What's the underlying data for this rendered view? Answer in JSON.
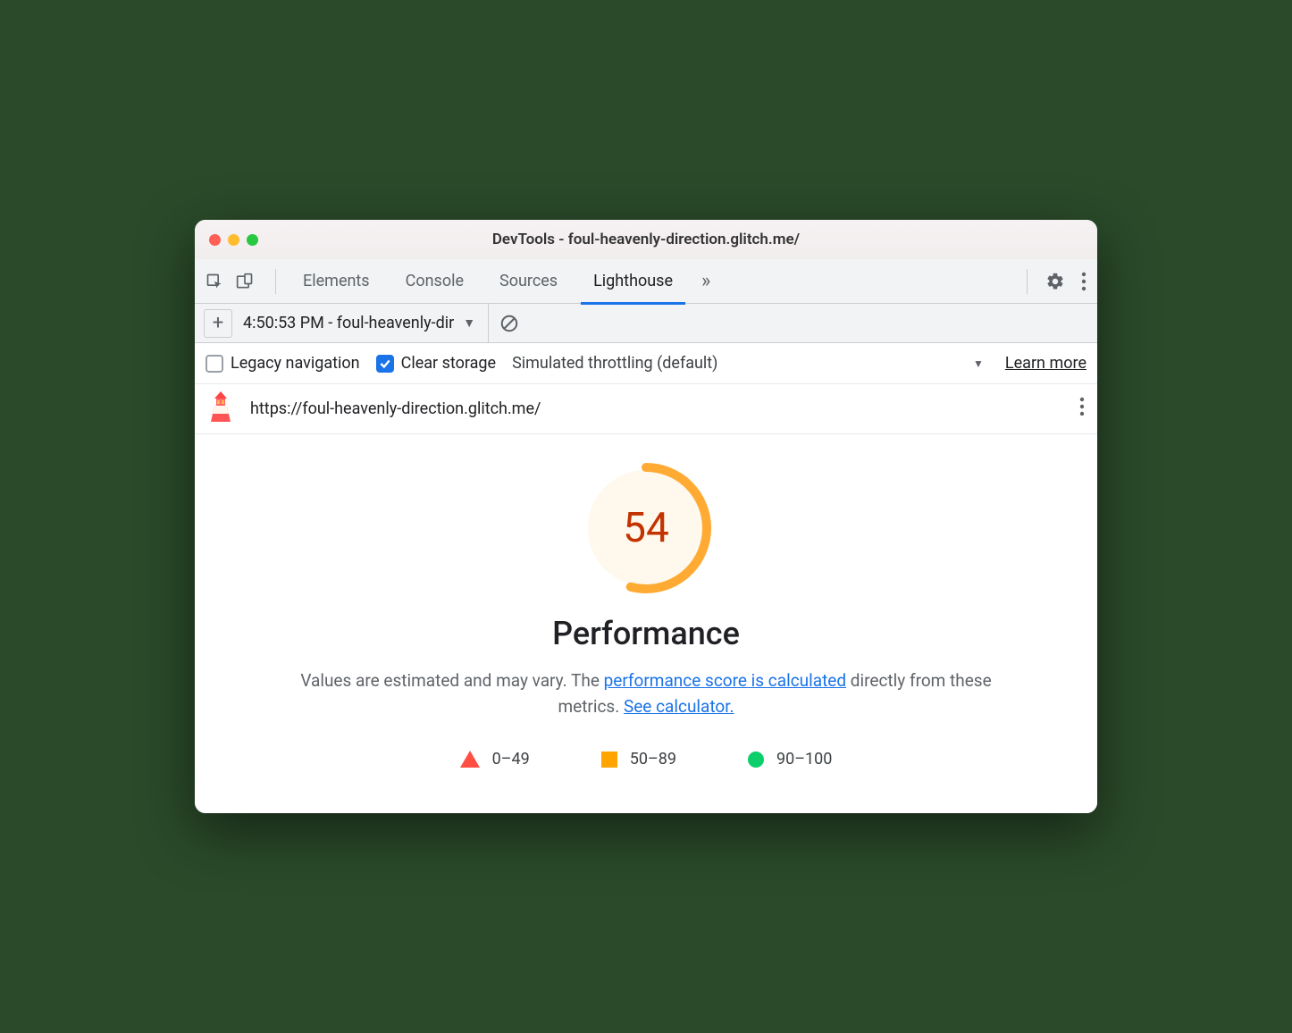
{
  "window": {
    "title": "DevTools - foul-heavenly-direction.glitch.me/"
  },
  "tabs": {
    "items": [
      "Elements",
      "Console",
      "Sources",
      "Lighthouse"
    ],
    "active": "Lighthouse"
  },
  "reportSelector": {
    "label": "4:50:53 PM - foul-heavenly-dir"
  },
  "options": {
    "legacy_navigation": {
      "label": "Legacy navigation",
      "checked": false
    },
    "clear_storage": {
      "label": "Clear storage",
      "checked": true
    },
    "throttling": "Simulated throttling (default)",
    "learn_more": "Learn more"
  },
  "urlRow": {
    "url": "https://foul-heavenly-direction.glitch.me/"
  },
  "performance": {
    "score": "54",
    "title": "Performance",
    "desc_pre": "Values are estimated and may vary. The ",
    "link1": "performance score is calculated",
    "desc_mid": " directly from these metrics. ",
    "link2": "See calculator."
  },
  "legend": {
    "r0": "0–49",
    "r1": "50–89",
    "r2": "90–100"
  },
  "colors": {
    "average": "#ffa400",
    "fail": "#ff4e42",
    "pass": "#0cce6b"
  }
}
